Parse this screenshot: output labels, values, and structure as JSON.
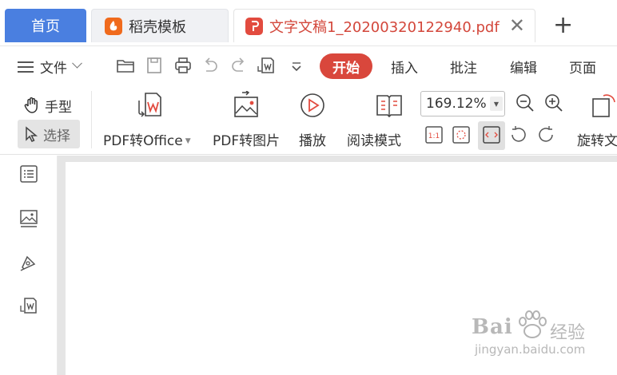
{
  "tabs": {
    "home": "首页",
    "daoke": "稻壳模板",
    "document": "文字文稿1_20200320122940.pdf",
    "close_symbol": "✕",
    "add_symbol": "+"
  },
  "menu": {
    "file": "文件",
    "tabs": [
      "开始",
      "插入",
      "批注",
      "编辑",
      "页面"
    ],
    "active_tab": "开始"
  },
  "ribbon": {
    "hand_mode": "手型",
    "select_mode": "选择",
    "pdf_to_office": "PDF转Office",
    "pdf_to_image": "PDF转图片",
    "play": "播放",
    "reading_mode": "阅读模式",
    "zoom_value": "169.12%",
    "rotate": "旋转文"
  },
  "watermark": {
    "brand": "Bai",
    "brand_cn": "经验",
    "url": "jingyan.baidu.com"
  },
  "colors": {
    "accent_red": "#d9473c",
    "home_tab_blue": "#4a7fe0",
    "daoke_orange": "#f06a1c"
  }
}
